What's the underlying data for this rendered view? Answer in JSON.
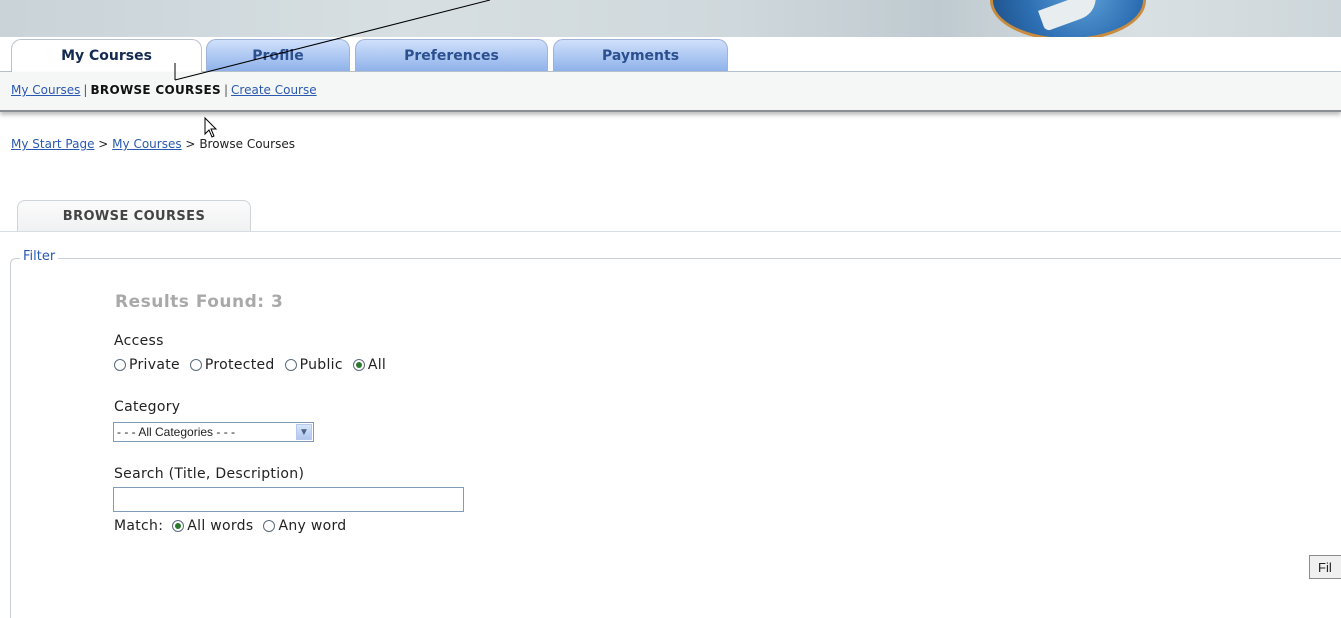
{
  "tabs": [
    {
      "label": "My Courses",
      "active": true
    },
    {
      "label": "Profile",
      "active": false
    },
    {
      "label": "Preferences",
      "active": false
    },
    {
      "label": "Payments",
      "active": false
    }
  ],
  "subnav": {
    "my_courses": "My Courses",
    "sep1": "|",
    "browse_courses": "BROWSE COURSES",
    "sep2": "|",
    "create_course": "Create Course"
  },
  "breadcrumb": {
    "start_page": "My Start Page",
    "sep1": ">",
    "my_courses": "My Courses",
    "sep2": ">",
    "current": "Browse Courses"
  },
  "section_tab": "BROWSE COURSES",
  "filter": {
    "legend": "Filter",
    "results": "Results Found: 3",
    "access_label": "Access",
    "access_options": [
      {
        "label": "Private",
        "checked": false
      },
      {
        "label": "Protected",
        "checked": false
      },
      {
        "label": "Public",
        "checked": false
      },
      {
        "label": "All",
        "checked": true
      }
    ],
    "category_label": "Category",
    "category_selected": "- - - All Categories - - -",
    "search_label": "Search (Title, Description)",
    "search_value": "",
    "match_label": "Match:",
    "match_options": [
      {
        "label": "All words",
        "checked": true
      },
      {
        "label": "Any word",
        "checked": false
      }
    ],
    "filter_button": "Fil"
  },
  "colors": {
    "link": "#2a59b0",
    "tab_inactive": "#8fb2ea",
    "tab_text": "#2c4f8f"
  }
}
